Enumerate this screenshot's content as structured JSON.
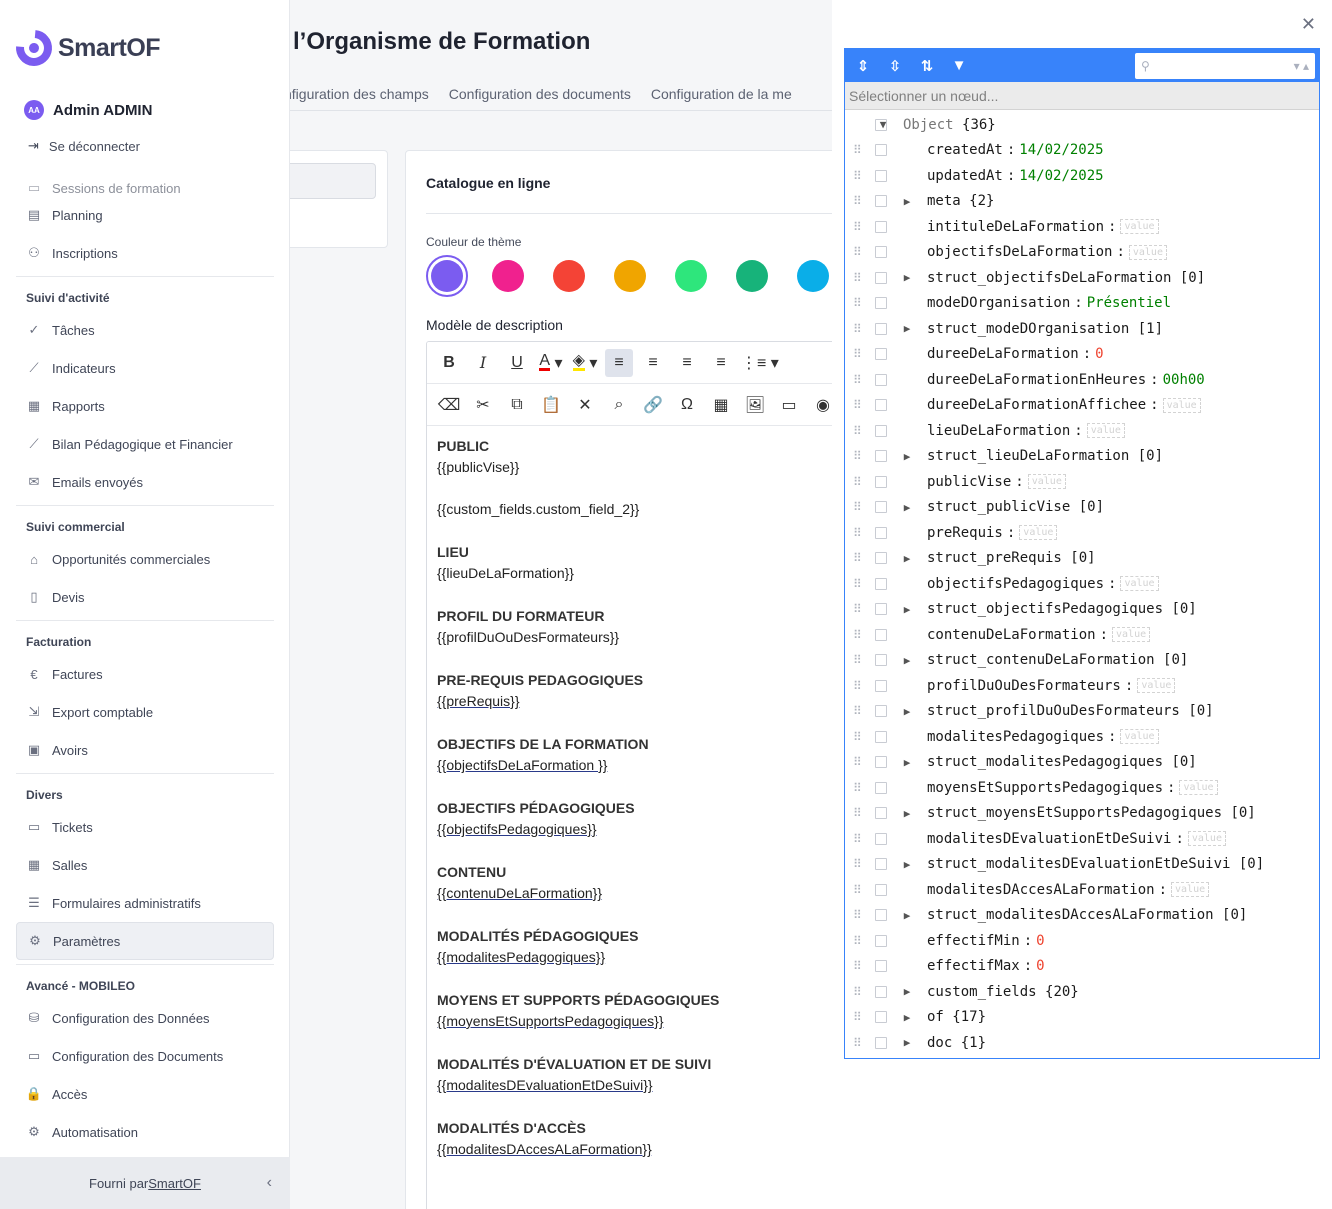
{
  "app": {
    "brand": "SmartOF",
    "footer_prefix": "Fourni par ",
    "footer_link": "SmartOF"
  },
  "user": {
    "initials": "AA",
    "name": "Admin ADMIN",
    "logout": "Se déconnecter"
  },
  "nav": {
    "top": [
      {
        "label": "Sessions de formation",
        "icon": "calendar-icon"
      },
      {
        "label": "Planning",
        "icon": "map-icon"
      },
      {
        "label": "Inscriptions",
        "icon": "user-plus-icon"
      }
    ],
    "sections": [
      {
        "title": "Suivi d'activité",
        "items": [
          {
            "label": "Tâches",
            "icon": "check-circle-icon"
          },
          {
            "label": "Indicateurs",
            "icon": "trend-icon"
          },
          {
            "label": "Rapports",
            "icon": "table-icon"
          },
          {
            "label": "Bilan Pédagogique et Financier",
            "icon": "chart-icon"
          },
          {
            "label": "Emails envoyés",
            "icon": "mail-icon"
          }
        ]
      },
      {
        "title": "Suivi commercial",
        "items": [
          {
            "label": "Opportunités commerciales",
            "icon": "tag-icon"
          },
          {
            "label": "Devis",
            "icon": "clipboard-icon"
          }
        ]
      },
      {
        "title": "Facturation",
        "items": [
          {
            "label": "Factures",
            "icon": "euro-icon"
          },
          {
            "label": "Export comptable",
            "icon": "file-export-icon"
          },
          {
            "label": "Avoirs",
            "icon": "banknote-icon"
          }
        ]
      },
      {
        "title": "Divers",
        "items": [
          {
            "label": "Tickets",
            "icon": "ticket-icon"
          },
          {
            "label": "Salles",
            "icon": "grid-icon"
          },
          {
            "label": "Formulaires administratifs",
            "icon": "list-icon"
          },
          {
            "label": "Paramètres",
            "icon": "gear-icon",
            "active": true
          }
        ]
      },
      {
        "title": "Avancé - MOBILEO",
        "items": [
          {
            "label": "Configuration des Données",
            "icon": "database-icon"
          },
          {
            "label": "Configuration des Documents",
            "icon": "folder-icon"
          },
          {
            "label": "Accès",
            "icon": "lock-icon"
          },
          {
            "label": "Automatisation",
            "icon": "gear-icon"
          }
        ]
      }
    ]
  },
  "main": {
    "title": "l’Organisme de Formation",
    "tabs": [
      "nfiguration des champs",
      "Configuration des documents",
      "Configuration de la me"
    ],
    "card_title": "Catalogue en ligne",
    "theme_label": "Couleur de thème",
    "swatches": [
      "#7b5cf0",
      "#f0218e",
      "#f44336",
      "#f0a500",
      "#2ee67c",
      "#17b37a",
      "#0aaee8"
    ],
    "desc_label": "Modèle de description",
    "doc": [
      {
        "h": "PUBLIC",
        "v": "{{publicVise}}",
        "u": false
      },
      {
        "h": "",
        "v": "{{custom_fields.custom_field_2}}",
        "u": false
      },
      {
        "h": "LIEU",
        "v": "{{lieuDeLaFormation}}",
        "u": false
      },
      {
        "h": "PROFIL DU FORMATEUR",
        "v": "{{profilDuOuDesFormateurs}}",
        "u": false
      },
      {
        "h": "PRE-REQUIS PEDAGOGIQUES",
        "v": "{{preRequis}}",
        "u": true
      },
      {
        "h": "OBJECTIFS DE LA FORMATION",
        "v": "{{objectifsDeLaFormation }}",
        "u": true
      },
      {
        "h": "OBJECTIFS PÉDAGOGIQUES",
        "v": "{{objectifsPedagogiques}}",
        "u": true
      },
      {
        "h": "CONTENU",
        "v": "{{contenuDeLaFormation}}",
        "u": true
      },
      {
        "h": "MODALITÉS PÉDAGOGIQUES",
        "v": "{{modalitesPedagogiques}}",
        "u": true
      },
      {
        "h": "MOYENS ET SUPPORTS PÉDAGOGIQUES",
        "v": "{{moyensEtSupportsPedagogiques}}",
        "u": true
      },
      {
        "h": "MODALITÉS D'ÉVALUATION ET DE SUIVI",
        "v": "{{modalitesDEvaluationEtDeSuivi}}",
        "u": true
      },
      {
        "h": "MODALITÉS D'ACCÈS",
        "v": "{{modalitesDAccesALaFormation}}",
        "u": true
      }
    ]
  },
  "json_editor": {
    "nav_placeholder": "Sélectionner un nœud...",
    "empty_placeholder": "value",
    "rows": [
      {
        "key": "Object",
        "meta": "{36}",
        "expand": "down",
        "level": 0,
        "root": true
      },
      {
        "key": "createdAt",
        "value": "14/02/2025",
        "type": "str",
        "level": 1
      },
      {
        "key": "updatedAt",
        "value": "14/02/2025",
        "type": "str",
        "level": 1
      },
      {
        "key": "meta",
        "meta": "{2}",
        "expand": "right",
        "level": 1
      },
      {
        "key": "intituleDeLaFormation",
        "type": "empty",
        "level": 1
      },
      {
        "key": "objectifsDeLaFormation",
        "type": "empty",
        "level": 1
      },
      {
        "key": "struct_objectifsDeLaFormation",
        "meta": "[0]",
        "expand": "right",
        "level": 1
      },
      {
        "key": "modeDOrganisation",
        "value": "Présentiel",
        "type": "str",
        "level": 1
      },
      {
        "key": "struct_modeDOrganisation",
        "meta": "[1]",
        "expand": "right",
        "level": 1
      },
      {
        "key": "dureeDeLaFormation",
        "value": "0",
        "type": "num",
        "level": 1
      },
      {
        "key": "dureeDeLaFormationEnHeures",
        "value": "00h00",
        "type": "str",
        "level": 1
      },
      {
        "key": "dureeDeLaFormationAffichee",
        "type": "empty",
        "level": 1
      },
      {
        "key": "lieuDeLaFormation",
        "type": "empty",
        "level": 1
      },
      {
        "key": "struct_lieuDeLaFormation",
        "meta": "[0]",
        "expand": "right",
        "level": 1
      },
      {
        "key": "publicVise",
        "type": "empty",
        "level": 1
      },
      {
        "key": "struct_publicVise",
        "meta": "[0]",
        "expand": "right",
        "level": 1
      },
      {
        "key": "preRequis",
        "type": "empty",
        "level": 1
      },
      {
        "key": "struct_preRequis",
        "meta": "[0]",
        "expand": "right",
        "level": 1
      },
      {
        "key": "objectifsPedagogiques",
        "type": "empty",
        "level": 1
      },
      {
        "key": "struct_objectifsPedagogiques",
        "meta": "[0]",
        "expand": "right",
        "level": 1
      },
      {
        "key": "contenuDeLaFormation",
        "type": "empty",
        "level": 1
      },
      {
        "key": "struct_contenuDeLaFormation",
        "meta": "[0]",
        "expand": "right",
        "level": 1
      },
      {
        "key": "profilDuOuDesFormateurs",
        "type": "empty",
        "level": 1
      },
      {
        "key": "struct_profilDuOuDesFormateurs",
        "meta": "[0]",
        "expand": "right",
        "level": 1
      },
      {
        "key": "modalitesPedagogiques",
        "type": "empty",
        "level": 1
      },
      {
        "key": "struct_modalitesPedagogiques",
        "meta": "[0]",
        "expand": "right",
        "level": 1
      },
      {
        "key": "moyensEtSupportsPedagogiques",
        "type": "empty",
        "level": 1
      },
      {
        "key": "struct_moyensEtSupportsPedagogiques",
        "meta": "[0]",
        "expand": "right",
        "level": 1
      },
      {
        "key": "modalitesDEvaluationEtDeSuivi",
        "type": "empty",
        "level": 1
      },
      {
        "key": "struct_modalitesDEvaluationEtDeSuivi",
        "meta": "[0]",
        "expand": "right",
        "level": 1
      },
      {
        "key": "modalitesDAccesALaFormation",
        "type": "empty",
        "level": 1
      },
      {
        "key": "struct_modalitesDAccesALaFormation",
        "meta": "[0]",
        "expand": "right",
        "level": 1
      },
      {
        "key": "effectifMin",
        "value": "0",
        "type": "num",
        "level": 1
      },
      {
        "key": "effectifMax",
        "value": "0",
        "type": "num",
        "level": 1
      },
      {
        "key": "custom_fields",
        "meta": "{20}",
        "expand": "right",
        "level": 1
      },
      {
        "key": "of",
        "meta": " {17}",
        "expand": "right",
        "level": 1
      },
      {
        "key": "doc",
        "meta": "{1}",
        "expand": "right",
        "level": 1
      }
    ]
  },
  "colors": {
    "accent": "#7b5cf0",
    "json_blue": "#3883fa",
    "json_str": "#008000",
    "json_num": "#ee422e"
  }
}
